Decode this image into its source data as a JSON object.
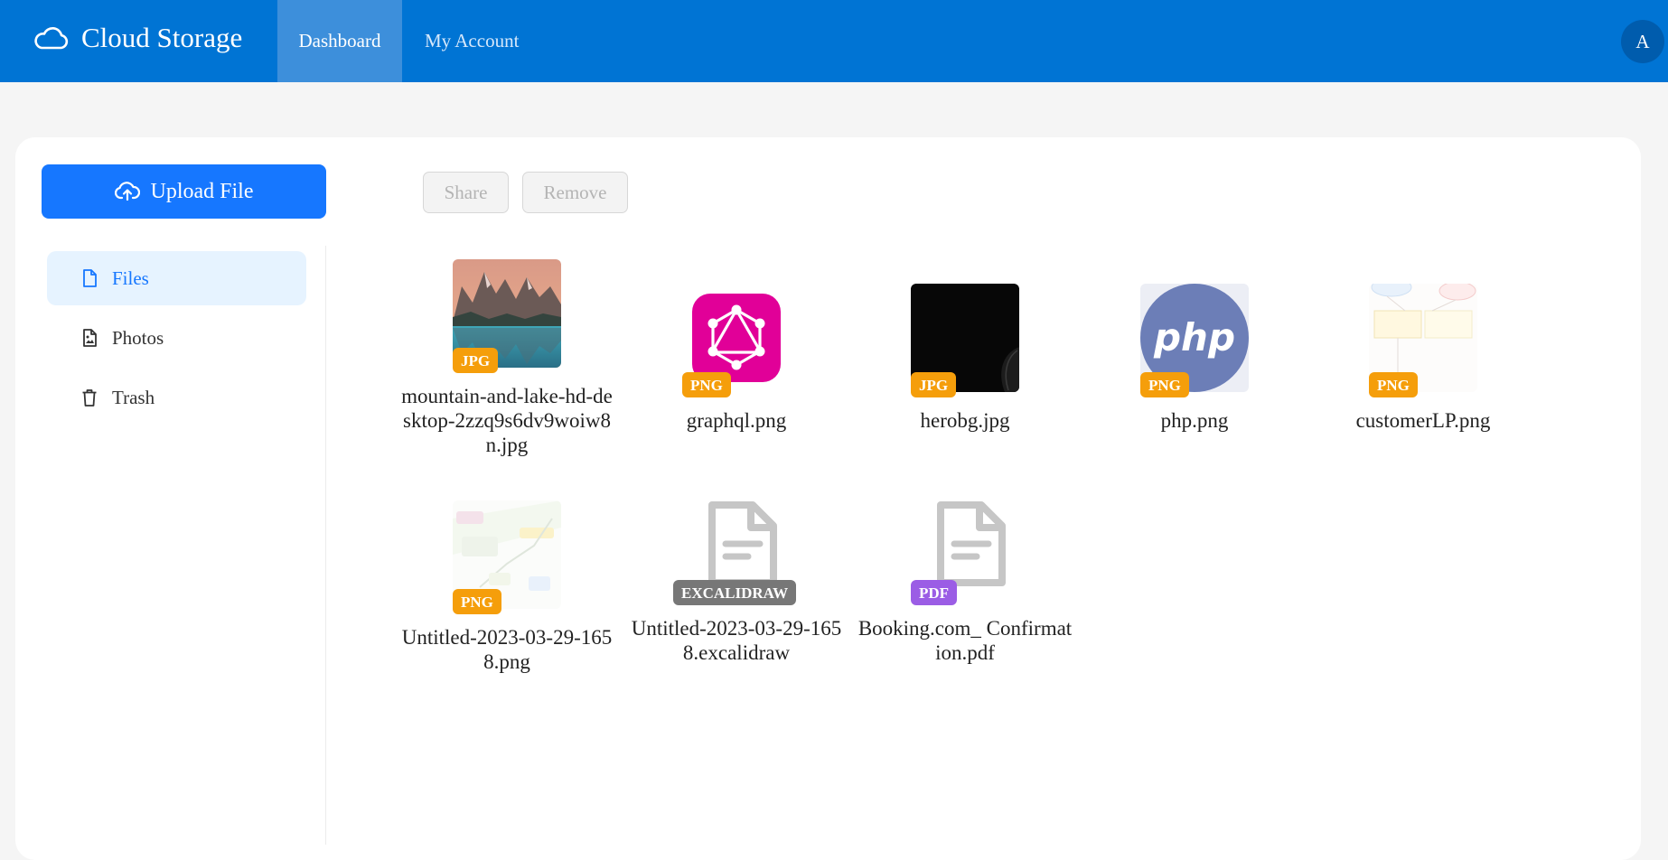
{
  "header": {
    "app_title": "Cloud Storage",
    "tabs": [
      {
        "label": "Dashboard",
        "active": true
      },
      {
        "label": "My Account",
        "active": false
      }
    ],
    "avatar_initial": "A",
    "colors": {
      "bar": "#0074d4",
      "active_tab": "#3d8fdb"
    }
  },
  "sidebar": {
    "upload_label": "Upload File",
    "items": [
      {
        "label": "Files",
        "icon": "file-icon",
        "active": true
      },
      {
        "label": "Photos",
        "icon": "photo-file-icon",
        "active": false
      },
      {
        "label": "Trash",
        "icon": "trash-icon",
        "active": false
      }
    ]
  },
  "toolbar": {
    "share_label": "Share",
    "remove_label": "Remove"
  },
  "files": [
    {
      "name": "mountain-and-lake-hd-desktop-2zzq9s6dv9woiw8n.jpg",
      "type": "JPG",
      "badge_color": "#f59e0b",
      "thumb": "mountain-lake-photo"
    },
    {
      "name": "graphql.png",
      "type": "PNG",
      "badge_color": "#f59e0b",
      "thumb": "graphql-logo"
    },
    {
      "name": "herobg.jpg",
      "type": "JPG",
      "badge_color": "#f59e0b",
      "thumb": "dark-background-photo"
    },
    {
      "name": "php.png",
      "type": "PNG",
      "badge_color": "#f59e0b",
      "thumb": "php-logo"
    },
    {
      "name": "customerLP.png",
      "type": "PNG",
      "badge_color": "#f59e0b",
      "thumb": "diagram-screenshot"
    },
    {
      "name": "Untitled-2023-03-29-1658.png",
      "type": "PNG",
      "badge_color": "#f59e0b",
      "thumb": "diagram-screenshot"
    },
    {
      "name": "Untitled-2023-03-29-1658.excalidraw",
      "type": "EXCALIDRAW",
      "badge_color": "#777777",
      "thumb": "document-icon"
    },
    {
      "name": "Booking.com_ Confirmation.pdf",
      "type": "PDF",
      "badge_color": "#9b5de5",
      "thumb": "document-icon"
    }
  ]
}
